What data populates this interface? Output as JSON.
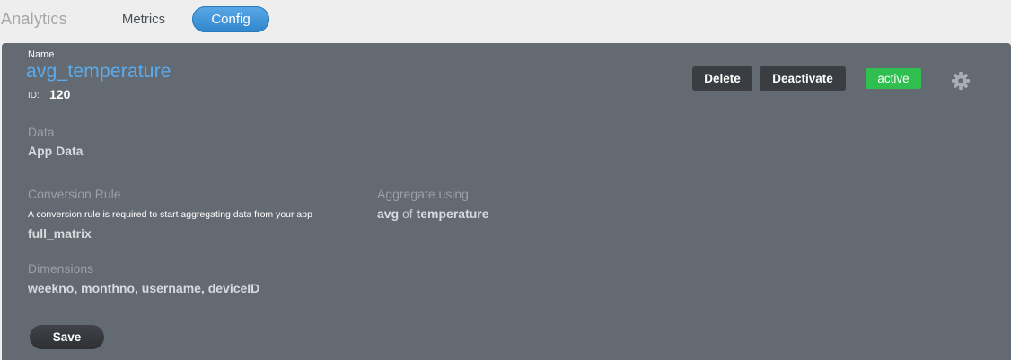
{
  "header": {
    "app_title": "Analytics",
    "tabs": [
      {
        "label": "Metrics",
        "active": false
      },
      {
        "label": "Config",
        "active": true
      }
    ]
  },
  "metric": {
    "name_label": "Name",
    "name": "avg_temperature",
    "id_label": "ID:",
    "id": "120",
    "actions": {
      "delete_label": "Delete",
      "deactivate_label": "Deactivate",
      "status": "active"
    },
    "data_label": "Data",
    "data_value": "App Data",
    "conversion_rule_label": "Conversion Rule",
    "conversion_rule_help": "A conversion rule is required to start aggregating data from your app",
    "conversion_rule_value": "full_matrix",
    "aggregate_label": "Aggregate using",
    "aggregate_func": "avg",
    "aggregate_of": "of",
    "aggregate_field": "temperature",
    "dimensions_label": "Dimensions",
    "dimensions_value": "weekno, monthno, username, deviceID",
    "save_label": "Save"
  },
  "colors": {
    "panel_bg": "#646a72",
    "accent_blue": "#5aabee",
    "active_green": "#2fbf4f",
    "button_dark": "#3a3d42"
  },
  "icons": {
    "settings": "gear-icon"
  }
}
